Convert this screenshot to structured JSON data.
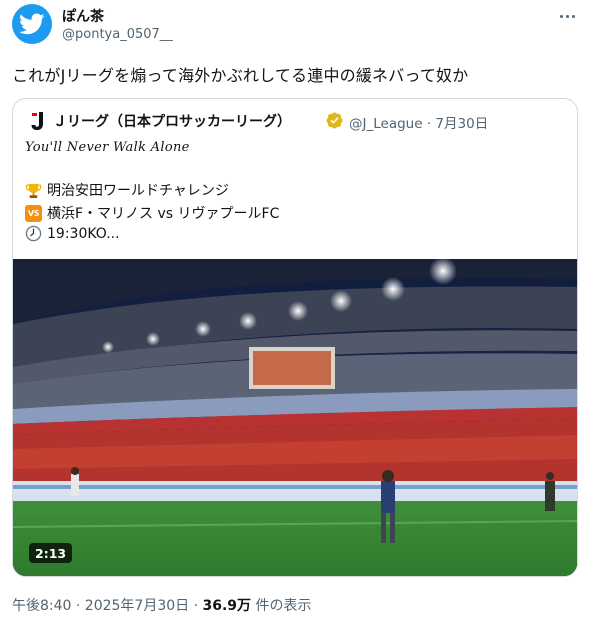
{
  "author": {
    "display_name": "ぽん茶",
    "handle": "@pontya_0507__",
    "avatar_icon": "twitter-bird-icon"
  },
  "tweet_text": "これがJリーグを煽って海外かぶれしてる連中の緩ネバって奴か",
  "quoted": {
    "name": "Ｊリーグ（日本プロサッカーリーグ）",
    "handle": "@J_League",
    "separator": "·",
    "date": "7月30日",
    "italic_line": "You'll Never Walk Alone",
    "lines": [
      {
        "icon": "trophy-icon",
        "text": "明治安田ワールドチャレンジ"
      },
      {
        "icon": "vs-icon",
        "icon_label": "VS",
        "text": "横浜F・マリノス vs リヴァプールFC"
      },
      {
        "icon": "clock-icon",
        "text": "19:30KO..."
      }
    ],
    "video_duration": "2:13"
  },
  "footer": {
    "time": "午後8:40 · 2025年7月30日 · ",
    "views_count": "36.9万",
    "views_label": " 件の表示"
  },
  "colors": {
    "brand": "#1d9bf0",
    "secondary_text": "#536471",
    "verified_gold": "#e2b719",
    "border": "#cfd9de"
  }
}
